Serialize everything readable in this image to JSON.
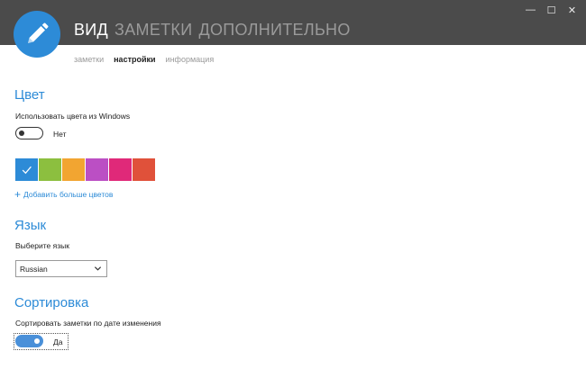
{
  "window": {
    "minimize_glyph": "—",
    "maximize_glyph": "☐",
    "close_glyph": "✕"
  },
  "logo": {
    "icon": "pencil-icon",
    "color": "#2d8bd7"
  },
  "main_nav": {
    "items": [
      {
        "label": "ВИД",
        "active": true
      },
      {
        "label": "ЗАМЕТКИ",
        "active": false
      },
      {
        "label": "ДОПОЛНИТЕЛЬНО",
        "active": false
      }
    ]
  },
  "sub_nav": {
    "items": [
      {
        "label": "заметки",
        "active": false
      },
      {
        "label": "настройки",
        "active": true
      },
      {
        "label": "информация",
        "active": false
      }
    ]
  },
  "color_section": {
    "title": "Цвет",
    "windows_colors_label": "Использовать цвета из Windows",
    "windows_colors_state": "Нет",
    "swatches": [
      {
        "color": "#2d8bd7",
        "selected": true
      },
      {
        "color": "#8cbf3f",
        "selected": false
      },
      {
        "color": "#f2a531",
        "selected": false
      },
      {
        "color": "#bb4fc4",
        "selected": false
      },
      {
        "color": "#e02979",
        "selected": false
      },
      {
        "color": "#e0513a",
        "selected": false
      }
    ],
    "add_colors_label": "Добавить больше цветов"
  },
  "language_section": {
    "title": "Язык",
    "choose_label": "Выберите язык",
    "selected_language": "Russian"
  },
  "sort_section": {
    "title": "Сортировка",
    "sort_label": "Сортировать заметки по дате изменения",
    "sort_state": "Да"
  }
}
